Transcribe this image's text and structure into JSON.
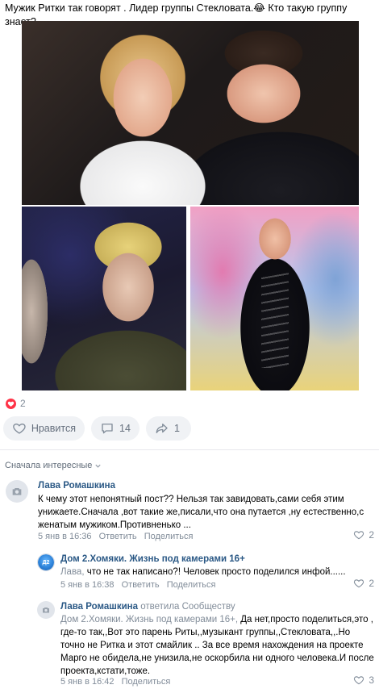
{
  "post": {
    "text": "Мужик Ритки так говорят . Лидер группы Стекловата.😂 Кто такую группу знает?",
    "reactions_count": "2",
    "actions": {
      "like_label": "Нравится",
      "comments_count": "14",
      "shares_count": "1"
    }
  },
  "comments_sort": {
    "label": "Сначала интересные"
  },
  "comments": [
    {
      "author": "Лава Ромашкина",
      "text": "К чему этот непонятный пост?? Нельзя так завидовать,сами себя этим унижаете.Сначала ,вот такие же,писали,что она путается ,ну естественно,с женатым мужиком.Противненько ...",
      "date": "5 янв в 16:36",
      "reply_label": "Ответить",
      "share_label": "Поделиться",
      "likes": "2"
    },
    {
      "author": "Дом 2.Хомяки. Жизнь под камерами 16+",
      "addressee": "Лава,",
      "text": " что не так написано?! Человек просто поделился инфой......",
      "date": "5 янв в 16:38",
      "reply_label": "Ответить",
      "share_label": "Поделиться",
      "likes": "2"
    },
    {
      "author": "Лава Ромашкина",
      "replied_to": "ответила Сообществу",
      "addressee": "Дом 2.Хомяки. Жизнь под камерами 16+,",
      "text": " Да нет,просто поделиться,это , где-то так,,Вот это парень Риты,,музыкант группы,,Стекловата,,.Но точно не Ритка и этот смайлик .. За все время нахождения на проекте Марго не обидела,не унизила,не оскорбила ни одного человека.И после проекта,кстати,тоже.",
      "date": "5 янв в 16:42",
      "share_label": "Поделиться",
      "likes": "3"
    }
  ],
  "colors": {
    "link": "#2a5885",
    "muted": "#818c99",
    "heart": "#ff3347",
    "button_bg": "#f0f2f5"
  }
}
